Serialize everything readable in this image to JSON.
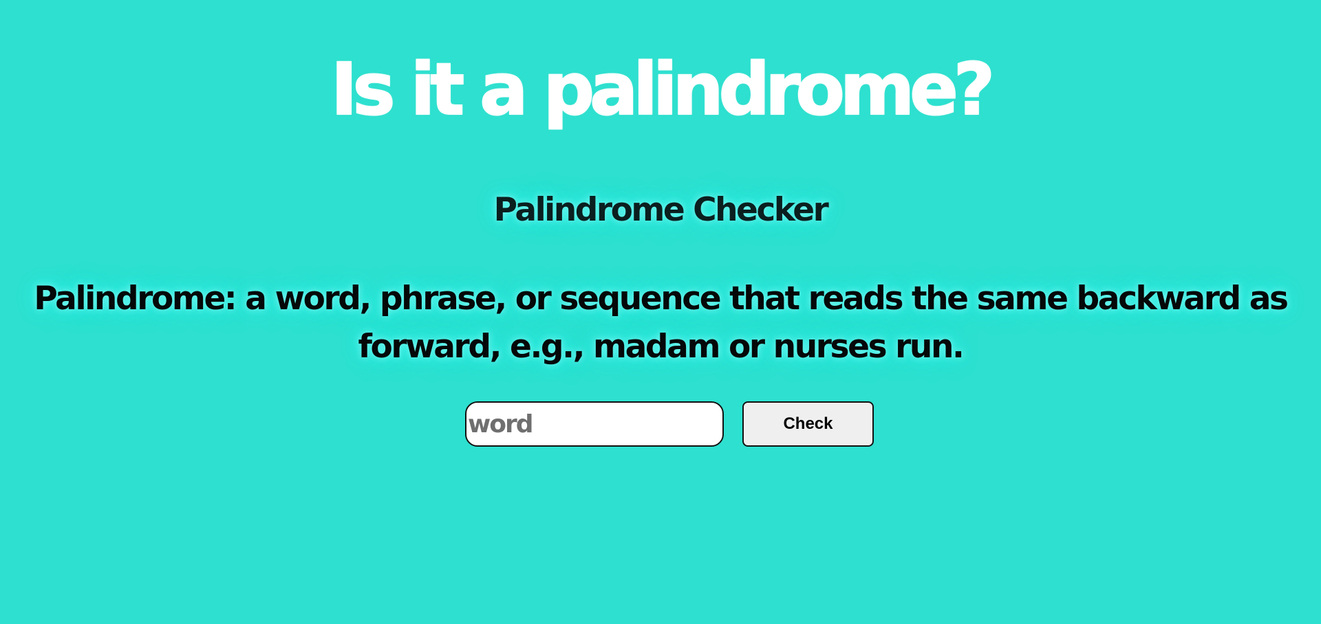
{
  "header": {
    "title": "Is it a palindrome?"
  },
  "main": {
    "subtitle": "Palindrome Checker",
    "definition": "Palindrome: a word, phrase, or sequence that reads the same backward as forward, e.g., madam or nurses run."
  },
  "form": {
    "input_placeholder": "word",
    "input_value": "",
    "check_label": "Check"
  },
  "colors": {
    "background": "#2ee0cf",
    "title": "#ffffff",
    "glow": "#24ece2",
    "text": "#050808"
  }
}
